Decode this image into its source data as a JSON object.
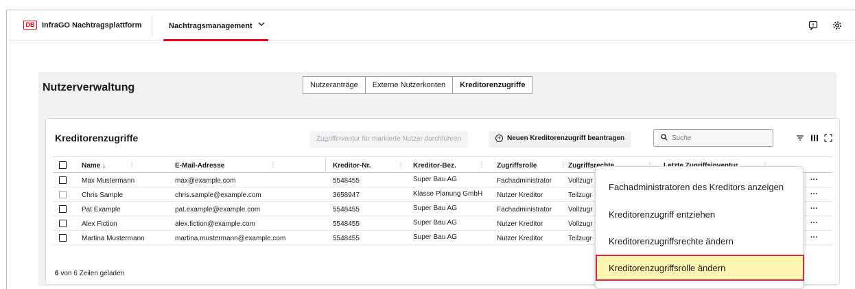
{
  "header": {
    "logo_text": "DB",
    "app_name": "InfraGO Nachtragsplattform",
    "menu_label": "Nachtragsmanagement",
    "menu_chevron": "chevron-down-icon",
    "accent_color": "#ec0016"
  },
  "page": {
    "title": "Nutzerverwaltung",
    "tabs": [
      {
        "label": "Nutzeranträge",
        "active": false
      },
      {
        "label": "Externe Nutzerkonten",
        "active": false
      },
      {
        "label": "Kreditorenzugriffe",
        "active": true
      }
    ]
  },
  "card": {
    "title": "Kreditorenzugriffe",
    "inventory_button": "Zugriffinventur für markierte Nutzer durchführen",
    "new_button": "Neuen Kreditorenzugriff beantragen",
    "search_placeholder": "Suche"
  },
  "table": {
    "columns": [
      "Name",
      "E-Mail-Adresse",
      "Kreditor-Nr.",
      "Kreditor-Bez.",
      "Zugriffsrolle",
      "Zugriffsrechte",
      "Letzte Zugriffsinventur"
    ],
    "sort_indicator": "↓",
    "rows": [
      {
        "name": "Max Mustermann",
        "email": "max@example.com",
        "nr": "5548455",
        "bez": "Super Bau AG",
        "rolle": "Fachadministrator",
        "rechte": "Vollzugr"
      },
      {
        "name": "Chris Sample",
        "email": "chris.sample@example.com",
        "nr": "3658947",
        "bez": "Klasse Planung GmbH",
        "rolle": "Nutzer Kreditor",
        "rechte": "Teilzugr"
      },
      {
        "name": "Pat Example",
        "email": "pat.example@example.com",
        "nr": "5548455",
        "bez": "Super Bau AG",
        "rolle": "Fachadministrator",
        "rechte": "Vollzugr"
      },
      {
        "name": "Alex Fiction",
        "email": "alex.fiction@example.com",
        "nr": "5548455",
        "bez": "Super Bau AG",
        "rolle": "Nutzer Kreditor",
        "rechte": "Vollzugr"
      },
      {
        "name": "Martina Mustermann",
        "email": "martina.mustermann@example.com",
        "nr": "5548455",
        "bez": "Super Bau AG",
        "rolle": "Nutzer Kreditor",
        "rechte": "Teilzugr"
      }
    ],
    "footer_count": "6",
    "footer_text": "von 6 Zeilen geladen",
    "row_menu": "···"
  },
  "dropdown": {
    "items": [
      "Fachadministratoren des Kreditors anzeigen",
      "Kreditorenzugriff entziehen",
      "Kreditorenzugriffsrechte ändern",
      "Kreditorenzugriffsrolle ändern"
    ],
    "highlighted_index": 3,
    "highlight_color": "#fdf5b2",
    "highlight_border": "#e4233c"
  }
}
